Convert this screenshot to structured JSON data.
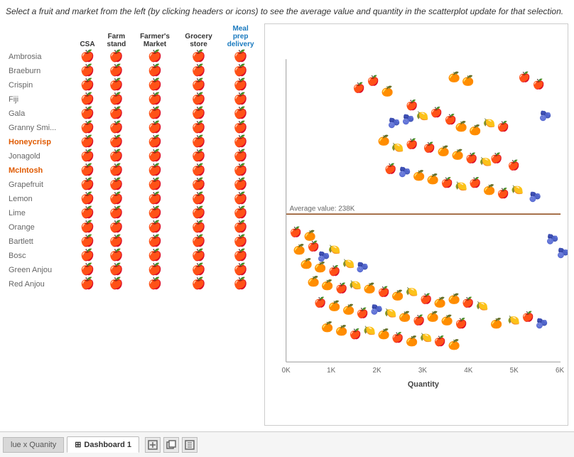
{
  "instruction": "Select a fruit and market from the left (by clicking headers or icons) to see the average value and quantity in the scatterplot update for that selection.",
  "table": {
    "columns": [
      "",
      "CSA",
      "Farm stand",
      "Farmer's Market",
      "Grocery store",
      "Meal prep delivery"
    ],
    "fruits": [
      {
        "name": "Ambrosia",
        "selected": false
      },
      {
        "name": "Braeburn",
        "selected": false
      },
      {
        "name": "Crispin",
        "selected": false
      },
      {
        "name": "Fiji",
        "selected": false
      },
      {
        "name": "Gala",
        "selected": false
      },
      {
        "name": "Granny Smi...",
        "selected": false
      },
      {
        "name": "Honeycrisp",
        "selected": true
      },
      {
        "name": "Jonagold",
        "selected": false
      },
      {
        "name": "McIntosh",
        "selected": true
      },
      {
        "name": "Grapefruit",
        "selected": false
      },
      {
        "name": "Lemon",
        "selected": false
      },
      {
        "name": "Lime",
        "selected": false
      },
      {
        "name": "Orange",
        "selected": false
      },
      {
        "name": "Bartlett",
        "selected": false
      },
      {
        "name": "Bosc",
        "selected": false
      },
      {
        "name": "Green Anjou",
        "selected": false
      },
      {
        "name": "Red Anjou",
        "selected": false
      }
    ]
  },
  "scatterplot": {
    "x_axis_label": "Quantity",
    "x_ticks": [
      "0K",
      "1K",
      "2K",
      "3K",
      "4K",
      "5K",
      "6K"
    ],
    "avg_line_label": "Average value: 238K"
  },
  "bottom_bar": {
    "partial_tab": "lue x Quanity",
    "active_tab": "Dashboard 1",
    "icons": [
      "grid-icon",
      "add-sheet-icon",
      "duplicate-sheet-icon"
    ]
  }
}
